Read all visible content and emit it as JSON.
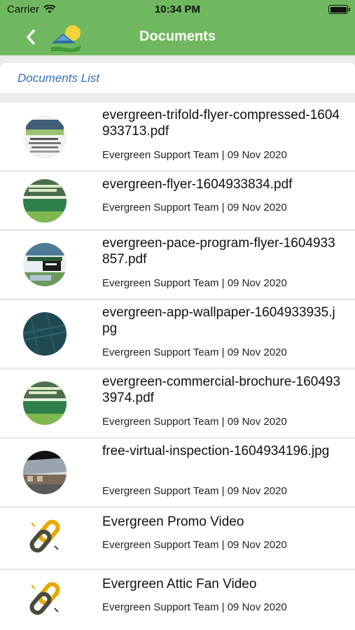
{
  "status_bar": {
    "carrier": "Carrier",
    "time": "10:34 PM"
  },
  "nav": {
    "title": "Documents",
    "back_icon": "chevron-left-icon",
    "logo": "solar-house-logo"
  },
  "section": {
    "title": "Documents List"
  },
  "documents": [
    {
      "name": "evergreen-trifold-flyer-compressed-1604933713.pdf",
      "meta": "Evergreen Support Team | 09 Nov 2020",
      "thumb": "flyer"
    },
    {
      "name": "evergreen-flyer-1604933834.pdf",
      "meta": "Evergreen Support Team | 09 Nov 2020",
      "thumb": "flyer"
    },
    {
      "name": "evergreen-pace-program-flyer-1604933857.pdf",
      "meta": "Evergreen Support Team | 09 Nov 2020",
      "thumb": "flyer"
    },
    {
      "name": "evergreen-app-wallpaper-1604933935.jpg",
      "meta": "Evergreen Support Team | 09 Nov 2020",
      "thumb": "wallpaper"
    },
    {
      "name": "evergreen-commercial-brochure-1604933974.pdf",
      "meta": "Evergreen Support Team | 09 Nov 2020",
      "thumb": "flyer"
    },
    {
      "name": "free-virtual-inspection-1604934196.jpg",
      "meta": "Evergreen Support Team | 09 Nov 2020",
      "thumb": "photo"
    },
    {
      "name": "Evergreen Promo Video",
      "meta": "Evergreen Support Team | 09 Nov 2020",
      "thumb": "link"
    },
    {
      "name": "Evergreen Attic Fan Video",
      "meta": "Evergreen Support Team | 09 Nov 2020",
      "thumb": "link"
    }
  ],
  "colors": {
    "header_green": "#6fb85f",
    "section_blue": "#2f6fb8",
    "link_gold": "#e8a800",
    "link_dark": "#4a4a3a"
  }
}
